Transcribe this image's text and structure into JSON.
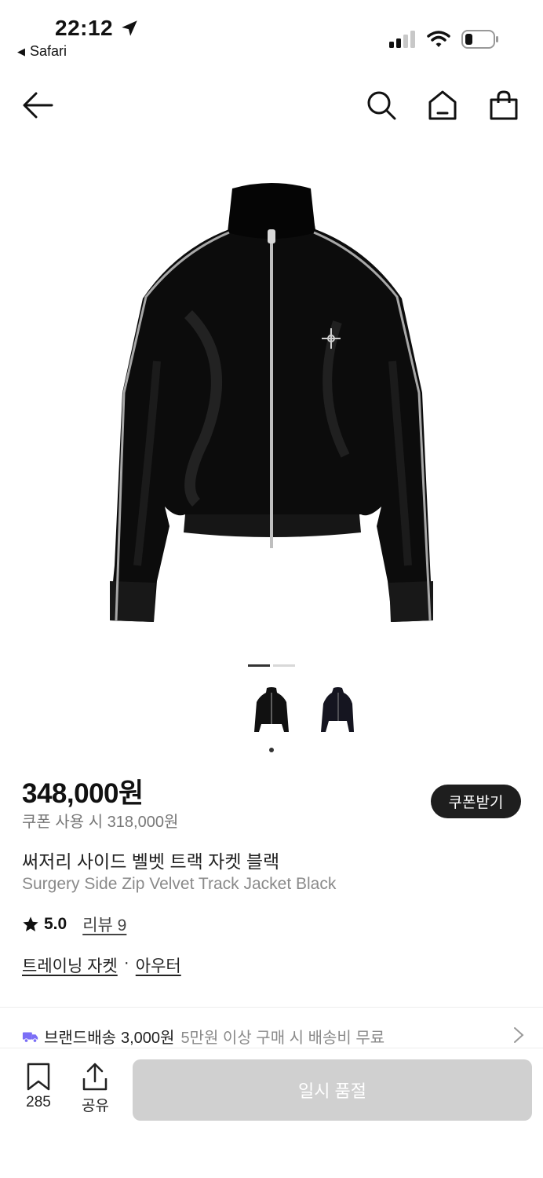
{
  "status_bar": {
    "time": "22:12",
    "back_app": "Safari"
  },
  "product": {
    "price": "348,000원",
    "coupon_price": "쿠폰 사용 시 318,000원",
    "coupon_button": "쿠폰받기",
    "name_ko": "써저리 사이드 벨벳 트랙 자켓 블랙",
    "name_en": "Surgery Side Zip Velvet Track Jacket Black",
    "rating": "5.0",
    "reviews": "리뷰 9",
    "category_primary": "트레이닝 자켓",
    "category_separator": "·",
    "category_secondary": "아우터"
  },
  "shipping": {
    "label": "브랜드배송",
    "amount": "3,000원",
    "note": "5만원 이상 구매 시 배송비 무료"
  },
  "bottom_bar": {
    "save_count": "285",
    "share_label": "공유",
    "soldout_label": "일시 품절"
  },
  "icons": [
    "back-arrow-icon",
    "search-icon",
    "home-icon",
    "shopping-bag-icon",
    "star-icon",
    "truck-icon",
    "chevron-right-icon",
    "bookmark-icon",
    "share-icon"
  ],
  "colors": {
    "coupon_button": "#1e1e1e",
    "soldout_button": "#d0d0d0",
    "truck_icon": "#7b6ef6"
  }
}
